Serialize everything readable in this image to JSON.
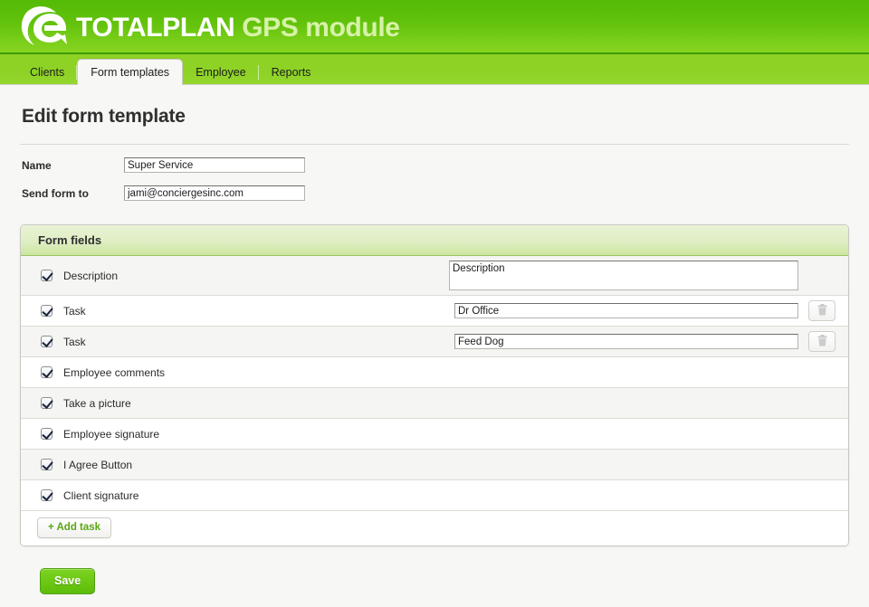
{
  "header": {
    "brand_main": "TOTALPLAN",
    "brand_sub": "GPS module",
    "logo_icon": "e-swoosh-logo"
  },
  "tabs": [
    {
      "label": "Clients",
      "active": false
    },
    {
      "label": "Form templates",
      "active": true
    },
    {
      "label": "Employee",
      "active": false
    },
    {
      "label": "Reports",
      "active": false
    }
  ],
  "page": {
    "title": "Edit form template"
  },
  "form": {
    "name_label": "Name",
    "name_value": "Super Service",
    "send_to_label": "Send form to",
    "send_to_value": "jami@conciergesinc.com"
  },
  "form_fields": {
    "panel_title": "Form fields",
    "rows": [
      {
        "label": "Description",
        "checked": true,
        "control": "textarea",
        "value": "Description",
        "deletable": false
      },
      {
        "label": "Task",
        "checked": true,
        "control": "input",
        "value": "Dr Office",
        "deletable": true
      },
      {
        "label": "Task",
        "checked": true,
        "control": "input",
        "value": "Feed Dog",
        "deletable": true
      },
      {
        "label": "Employee comments",
        "checked": true,
        "control": "none",
        "value": "",
        "deletable": false
      },
      {
        "label": "Take a picture",
        "checked": true,
        "control": "none",
        "value": "",
        "deletable": false
      },
      {
        "label": "Employee signature",
        "checked": true,
        "control": "none",
        "value": "",
        "deletable": false
      },
      {
        "label": "I Agree Button",
        "checked": true,
        "control": "none",
        "value": "",
        "deletable": false
      },
      {
        "label": "Client signature",
        "checked": true,
        "control": "none",
        "value": "",
        "deletable": false
      }
    ],
    "add_task_label": "+ Add task",
    "delete_icon": "trash-icon"
  },
  "actions": {
    "save_label": "Save"
  },
  "colors": {
    "header_green_top": "#53bb06",
    "header_green_bottom": "#86d420",
    "tabbar_green": "#8ed225",
    "panel_head_green": "#cbe5a0",
    "save_green": "#6cc814",
    "add_task_text": "#5ba614"
  }
}
